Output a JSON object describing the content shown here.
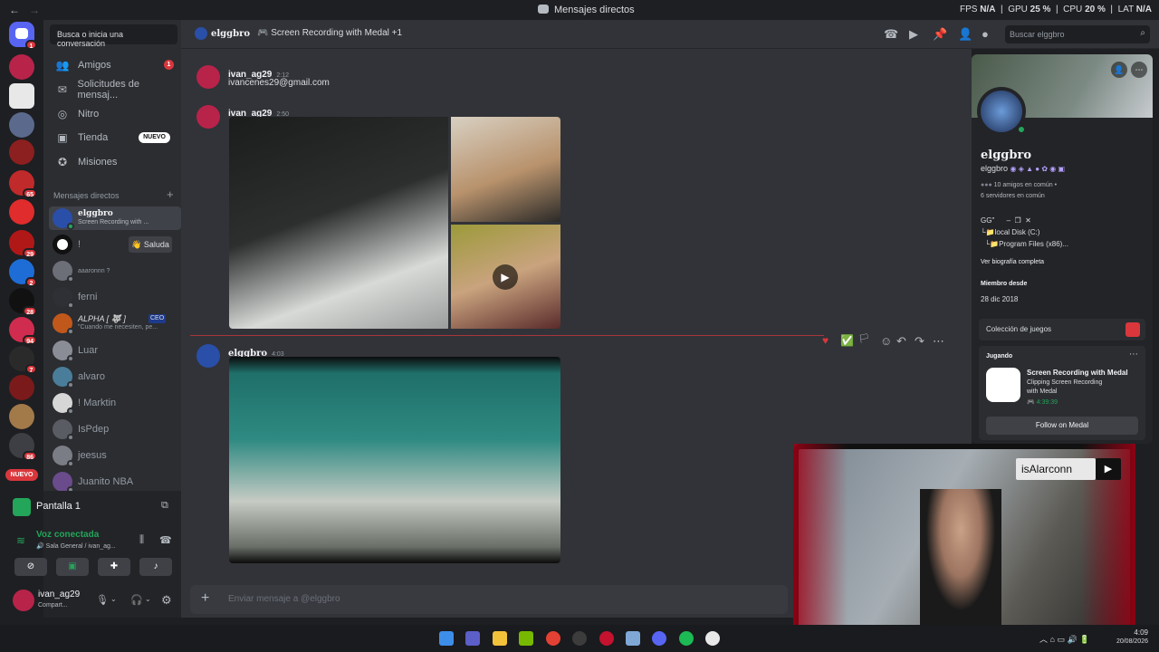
{
  "topbar": {
    "title": "Mensajes directos",
    "fps_label": "FPS",
    "fps_value": "N/A",
    "gpu_label": "GPU",
    "gpu_value": "25 %",
    "cpu_label": "CPU",
    "cpu_value": "20 %",
    "lat_label": "LAT",
    "lat_value": "N/A"
  },
  "servers": {
    "home_badge": "1",
    "badges": [
      "65",
      "29",
      "2",
      "28",
      "94",
      "7",
      "86"
    ],
    "new_label": "NUEVO"
  },
  "search_conv": "Busca o inicia una conversación",
  "nav": [
    {
      "label": "Amigos",
      "badge": "1"
    },
    {
      "label": "Solicitudes de mensaj..."
    },
    {
      "label": "Nitro"
    },
    {
      "label": "Tienda",
      "badge": "NUEVO"
    },
    {
      "label": "Misiones"
    }
  ],
  "dm_header": "Mensajes directos",
  "dms": [
    {
      "name": "elggbro",
      "sub": "Screen Recording with ..."
    },
    {
      "name": "!",
      "action": "Saluda"
    },
    {
      "name": "aaaronnn ?"
    },
    {
      "name": "ferni"
    },
    {
      "name": "ALPHA [ 🐺 ]",
      "tag": "CEO",
      "sub": "\"Cuando me necesiten, pe..."
    },
    {
      "name": "Luar"
    },
    {
      "name": "alvaro"
    },
    {
      "name": "! Marktin"
    },
    {
      "name": "IsPdep"
    },
    {
      "name": "jeesus"
    },
    {
      "name": "Juanito NBA"
    }
  ],
  "screen_share": {
    "title": "Pantalla 1"
  },
  "voice": {
    "title": "Voz conectada",
    "channel": "Sala General / ivan_ag..."
  },
  "user": {
    "name": "ivan_ag29",
    "status": "Compart..."
  },
  "chat_header": {
    "name": "elggbro",
    "activity": "Screen Recording with Medal +1",
    "search_placeholder": "Buscar elggbro"
  },
  "messages": [
    {
      "author": "ivan_ag29",
      "time": "2:12",
      "text": "ivancenes29@gmail.com"
    },
    {
      "author": "ivan_ag29",
      "time": "2:50"
    },
    {
      "author": "elggbro",
      "time": "4:03"
    }
  ],
  "composer_placeholder": "Enviar mensaje a @elggbro",
  "profile": {
    "display_name": "elggbro",
    "username": "elggbro",
    "mutual_friends": "10 amigos en común",
    "mutual_servers": "6 servidores en común",
    "bio_line1": "GG\"      –  ❐  ✕",
    "bio_line2": "└📁local Disk (C:)",
    "bio_line3": "  └📁Program Files (x86)...",
    "bio_link": "Ver biografía completa",
    "member_since_label": "Miembro desde",
    "member_since": "28 dic 2018",
    "games_label": "Colección de juegos",
    "playing_label": "Jugando",
    "game_title": "Screen Recording with Medal",
    "game_sub1": "Clipping Screen Recording",
    "game_sub2": "with Medal",
    "game_time": "4:39:39",
    "follow": "Follow on Medal"
  },
  "webcam": {
    "channel": "isAlarconn"
  },
  "clock": {
    "time": "4:09",
    "date": "20/08/2026"
  },
  "colors": {
    "accent": "#5865f2",
    "green": "#23a55a",
    "red": "#da373c",
    "bg": "#313338"
  }
}
